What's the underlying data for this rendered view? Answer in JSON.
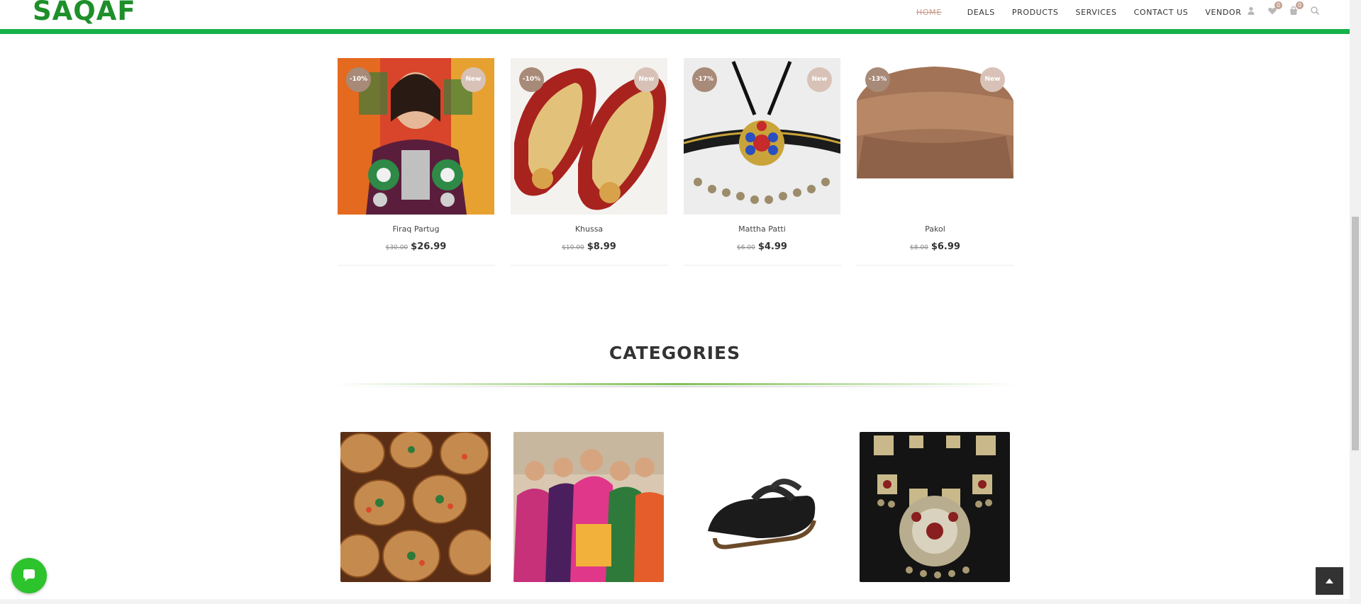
{
  "brand": {
    "logo_text": "SAQAF",
    "accent_green": "#17b14a",
    "logo_color": "#1e8f2a"
  },
  "nav": {
    "items": [
      {
        "label": "HOME",
        "active": true
      },
      {
        "label": "DEALS"
      },
      {
        "label": "PRODUCTS"
      },
      {
        "label": "SERVICES"
      },
      {
        "label": "CONTACT US"
      },
      {
        "label": "VENDOR"
      }
    ],
    "icons": [
      {
        "name": "user-icon"
      },
      {
        "name": "heart-icon",
        "badge": "0"
      },
      {
        "name": "cart-icon",
        "badge": "0"
      },
      {
        "name": "search-icon"
      }
    ]
  },
  "products": [
    {
      "name": "Firaq Partug",
      "discount": "-10%",
      "badge": "New",
      "old_price": "$30.00",
      "price": "$26.99"
    },
    {
      "name": "Khussa",
      "discount": "-10%",
      "badge": "New",
      "old_price": "$10.00",
      "price": "$8.99"
    },
    {
      "name": "Mattha Patti",
      "discount": "-17%",
      "badge": "New",
      "old_price": "$6.00",
      "price": "$4.99"
    },
    {
      "name": "Pakol",
      "discount": "-13%",
      "badge": "New",
      "old_price": "$8.00",
      "price": "$6.99"
    }
  ],
  "categories": {
    "title": "CATEGORIES",
    "images": [
      {
        "icon": "pottery-image"
      },
      {
        "icon": "girls-image"
      },
      {
        "icon": "sandal-image"
      },
      {
        "icon": "necklace-image"
      }
    ]
  },
  "widgets": {
    "chat_icon": "chat-icon",
    "top_icon": "arrow-up-icon"
  }
}
